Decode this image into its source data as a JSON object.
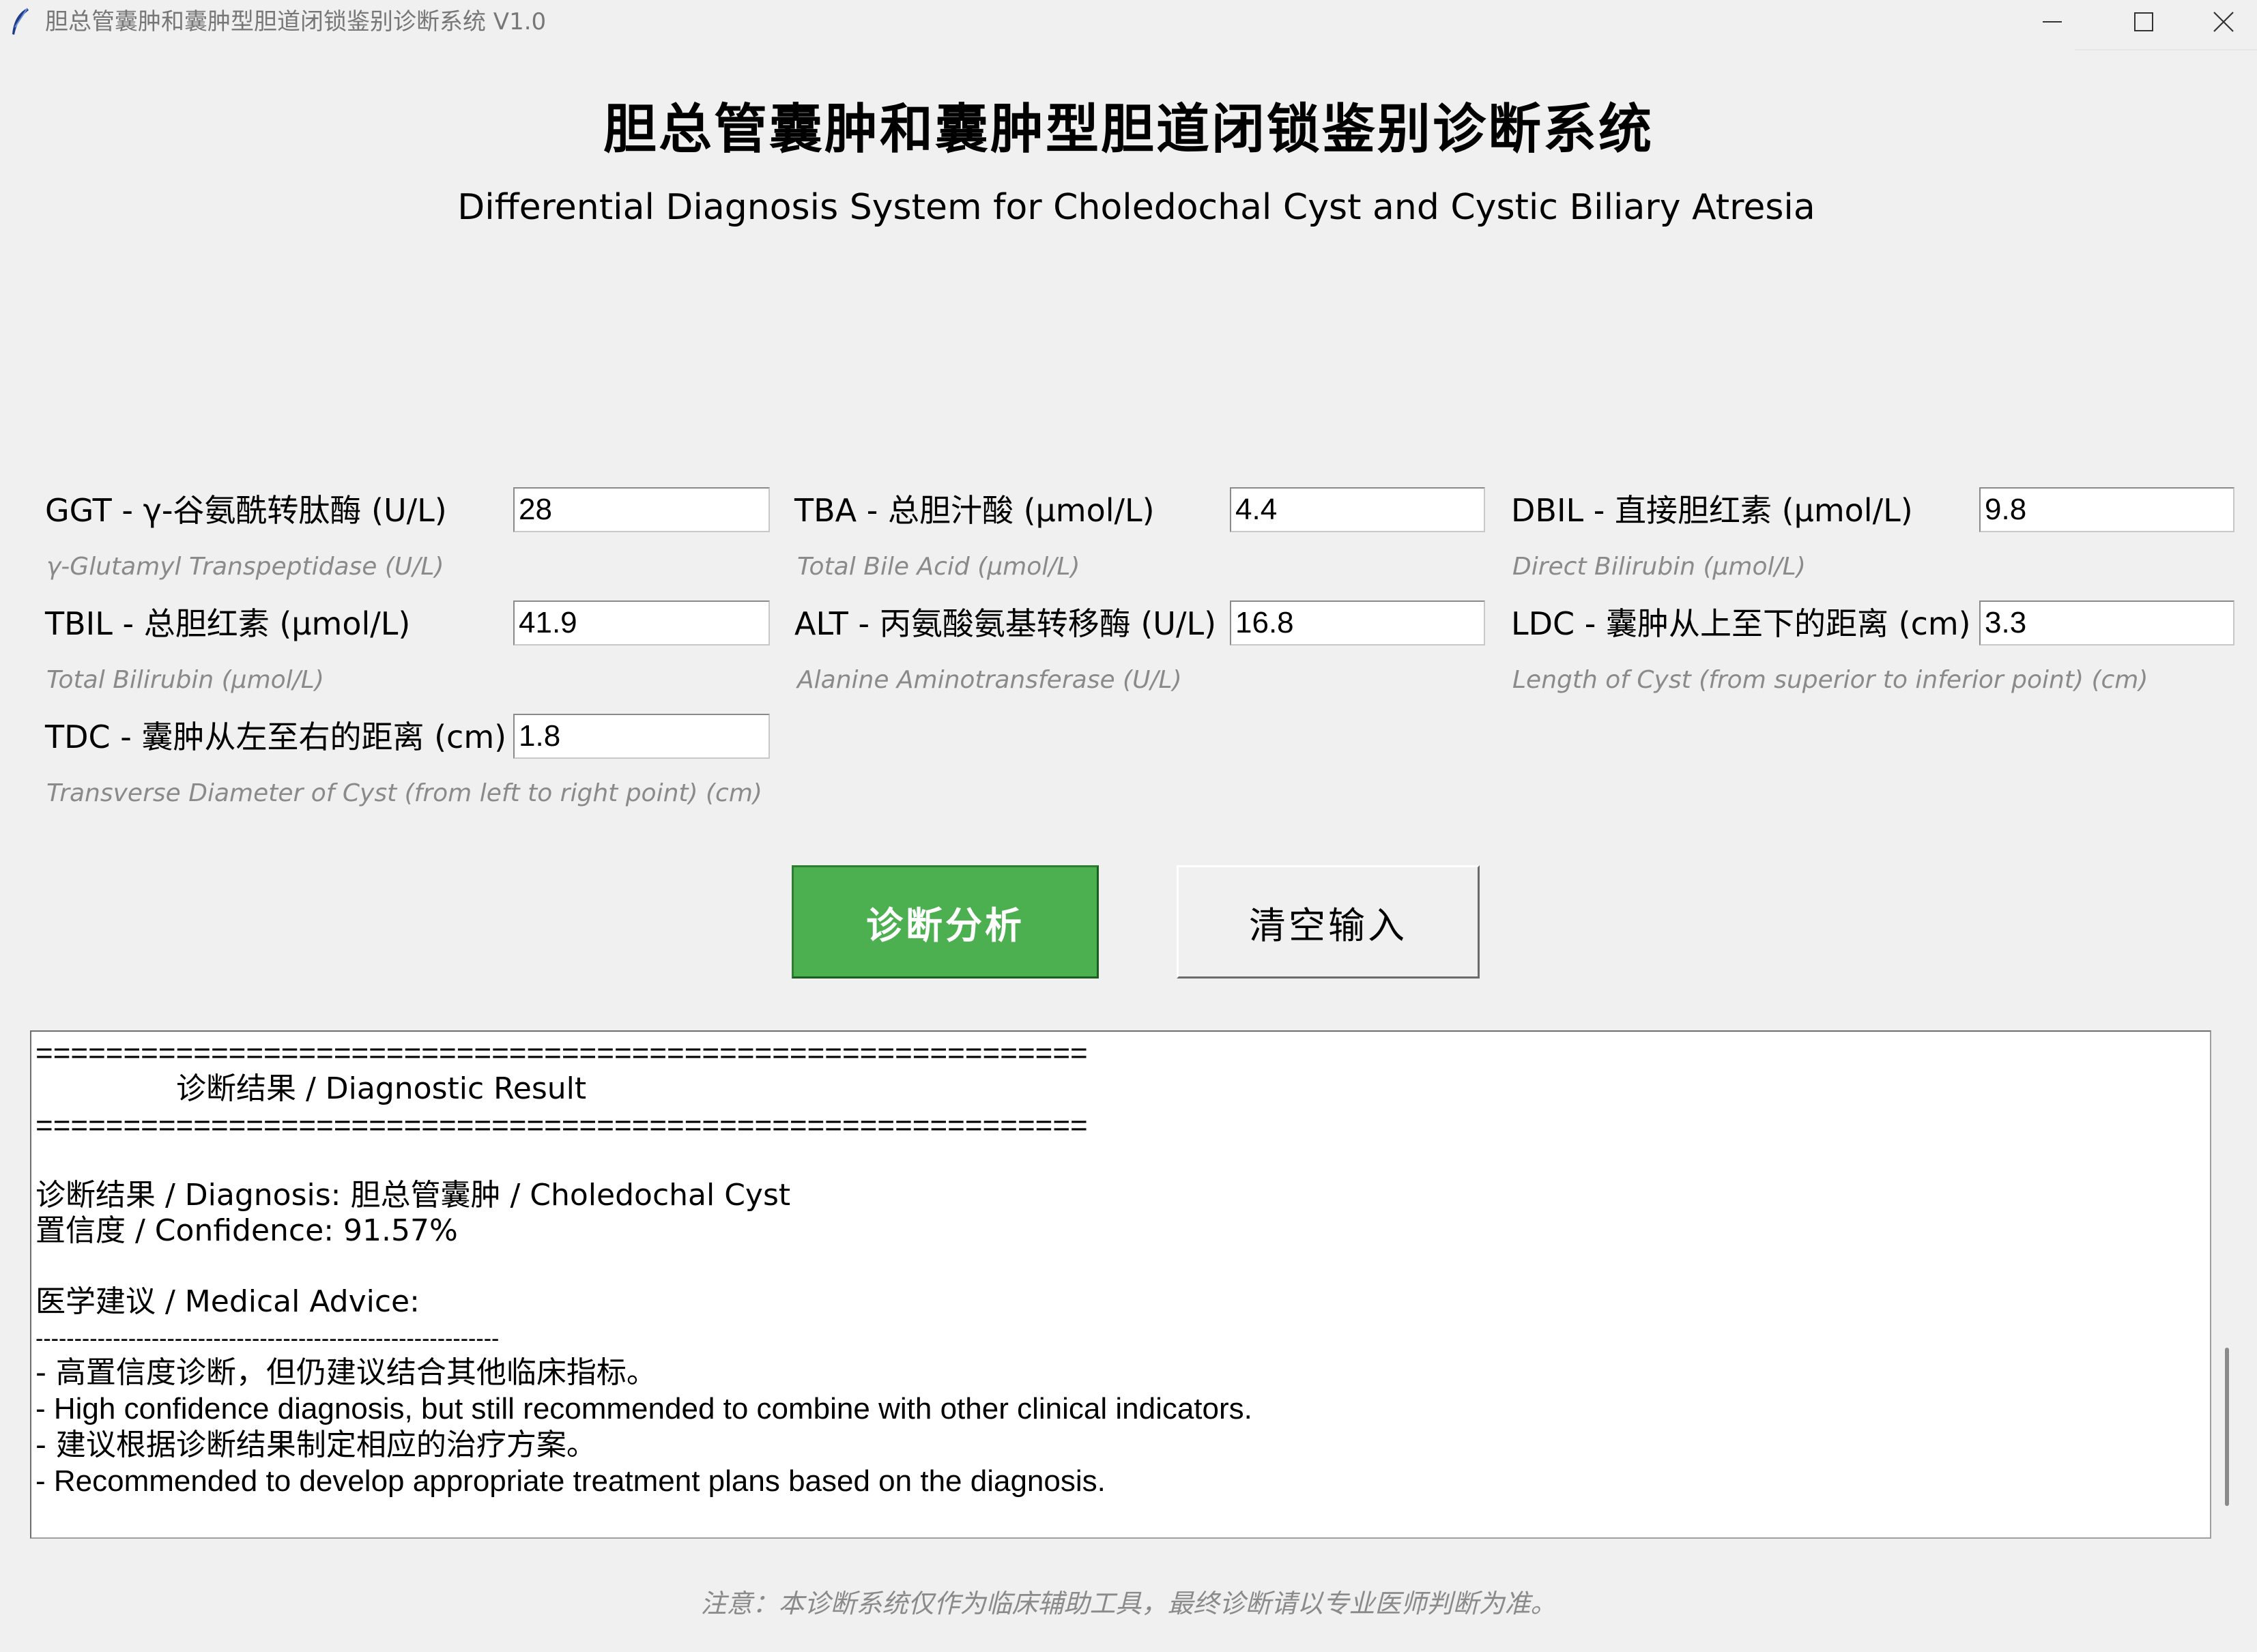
{
  "window": {
    "title": "胆总管囊肿和囊肿型胆道闭锁鉴别诊断系统 V1.0",
    "icon": "feather-icon"
  },
  "header": {
    "title": "胆总管囊肿和囊肿型胆道闭锁鉴别诊断系统",
    "subtitle": "Differential Diagnosis System for Choledochal Cyst and Cystic Biliary Atresia"
  },
  "fields": [
    {
      "key": "ggt",
      "label": "GGT - γ-谷氨酰转肽酶 (U/L)",
      "value": "28",
      "hint": "γ-Glutamyl Transpeptidase (U/L)"
    },
    {
      "key": "tba",
      "label": "TBA - 总胆汁酸 (μmol/L)",
      "value": "4.4",
      "hint": "Total Bile Acid (μmol/L)"
    },
    {
      "key": "dbil",
      "label": "DBIL - 直接胆红素 (μmol/L)",
      "value": "9.8",
      "hint": "Direct Bilirubin (μmol/L)"
    },
    {
      "key": "tbil",
      "label": "TBIL - 总胆红素 (μmol/L)",
      "value": "41.9",
      "hint": "Total Bilirubin (μmol/L)"
    },
    {
      "key": "alt",
      "label": "ALT - 丙氨酸氨基转移酶 (U/L)",
      "value": "16.8",
      "hint": "Alanine Aminotransferase (U/L)"
    },
    {
      "key": "ldc",
      "label": "LDC - 囊肿从上至下的距离 (cm)",
      "value": "3.3",
      "hint": "Length of Cyst (from superior to inferior point) (cm)"
    },
    {
      "key": "tdc",
      "label": "TDC - 囊肿从左至右的距离 (cm)",
      "value": "1.8",
      "hint": "Transverse Diameter of Cyst (from left to right point) (cm)"
    }
  ],
  "buttons": {
    "diagnose": "诊断分析",
    "clear": "清空输入"
  },
  "result": {
    "separator": "============================================================",
    "heading": "诊断结果 / Diagnostic Result",
    "diagnosis": "诊断结果 / Diagnosis: 胆总管囊肿 / Choledochal Cyst",
    "confidence": "置信度 / Confidence: 91.57%",
    "advice_heading": "医学建议 / Medical Advice:",
    "dash_separator": "------------------------------------------------------------",
    "advice": [
      "- 高置信度诊断，但仍建议结合其他临床指标。",
      "- High confidence diagnosis, but still recommended to combine with other clinical indicators.",
      "- 建议根据诊断结果制定相应的治疗方案。",
      "- Recommended to develop appropriate treatment plans based on the diagnosis."
    ]
  },
  "footer": {
    "note": "注意：本诊断系统仅作为临床辅助工具，最终诊断请以专业医师判断为准。"
  },
  "colors": {
    "diagnose_button": "#4caf50",
    "background": "#f0f0f0",
    "hint_text": "#8a8a8a"
  }
}
